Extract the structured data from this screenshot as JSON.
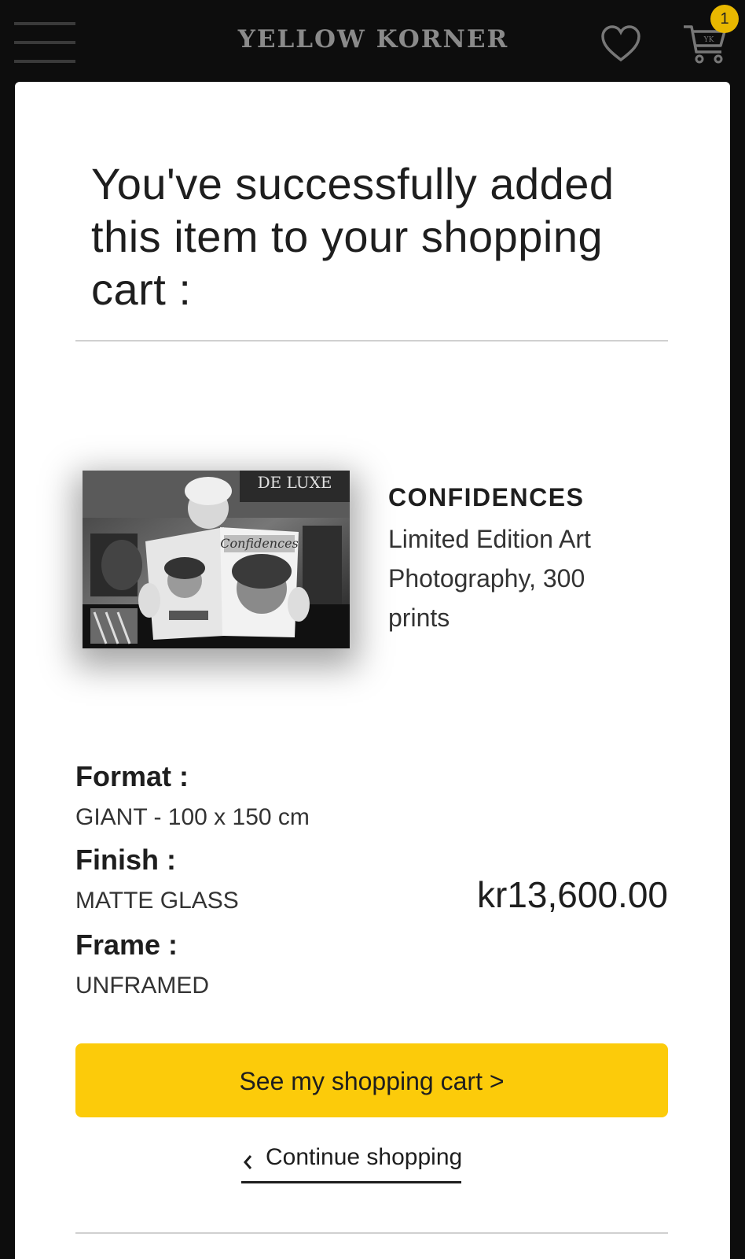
{
  "header": {
    "brand": "YELLOW KORNER",
    "cart_count": "1",
    "cart_icon_text": "YK"
  },
  "modal": {
    "heading": "You've successfully added this item to your shopping cart :",
    "product": {
      "name": "CONFIDENCES",
      "description": "Limited Edition Art Photography, 300 prints",
      "image_sign_text": "DE LUXE",
      "image_magazine_text": "Confidences"
    },
    "attributes": {
      "format_label": "Format :",
      "format_value": "GIANT - 100 x 150 cm",
      "finish_label": "Finish :",
      "finish_value": "MATTE GLASS",
      "frame_label": "Frame :",
      "frame_value": "UNFRAMED"
    },
    "price": "kr13,600.00",
    "cta_label": "See my shopping cart >",
    "continue_label": "Continue shopping"
  },
  "colors": {
    "accent": "#fccb0a",
    "badge": "#e8b800",
    "header_bg": "#0d0d0d"
  }
}
